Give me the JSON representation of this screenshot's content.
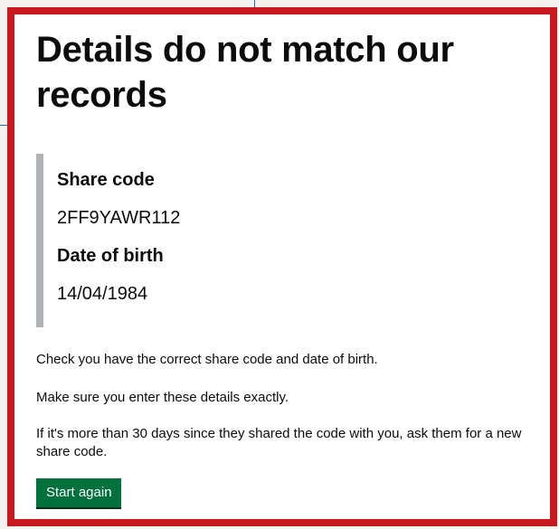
{
  "page": {
    "title": "Details do not match our records"
  },
  "details": {
    "share_code_label": "Share code",
    "share_code_value": "2FF9YAWR112",
    "dob_label": "Date of birth",
    "dob_value": "14/04/1984"
  },
  "guidance": {
    "line1": "Check you have the correct share code and date of birth.",
    "line2": "Make sure you enter these details exactly.",
    "line3": "If it's more than 30 days since they shared the code with you, ask them for a new share code."
  },
  "actions": {
    "start_again_label": "Start again"
  },
  "colors": {
    "frame_border": "#c8191e",
    "button_green": "#00703c",
    "inset_border": "#b1b4b6",
    "text": "#0b0c0c"
  }
}
